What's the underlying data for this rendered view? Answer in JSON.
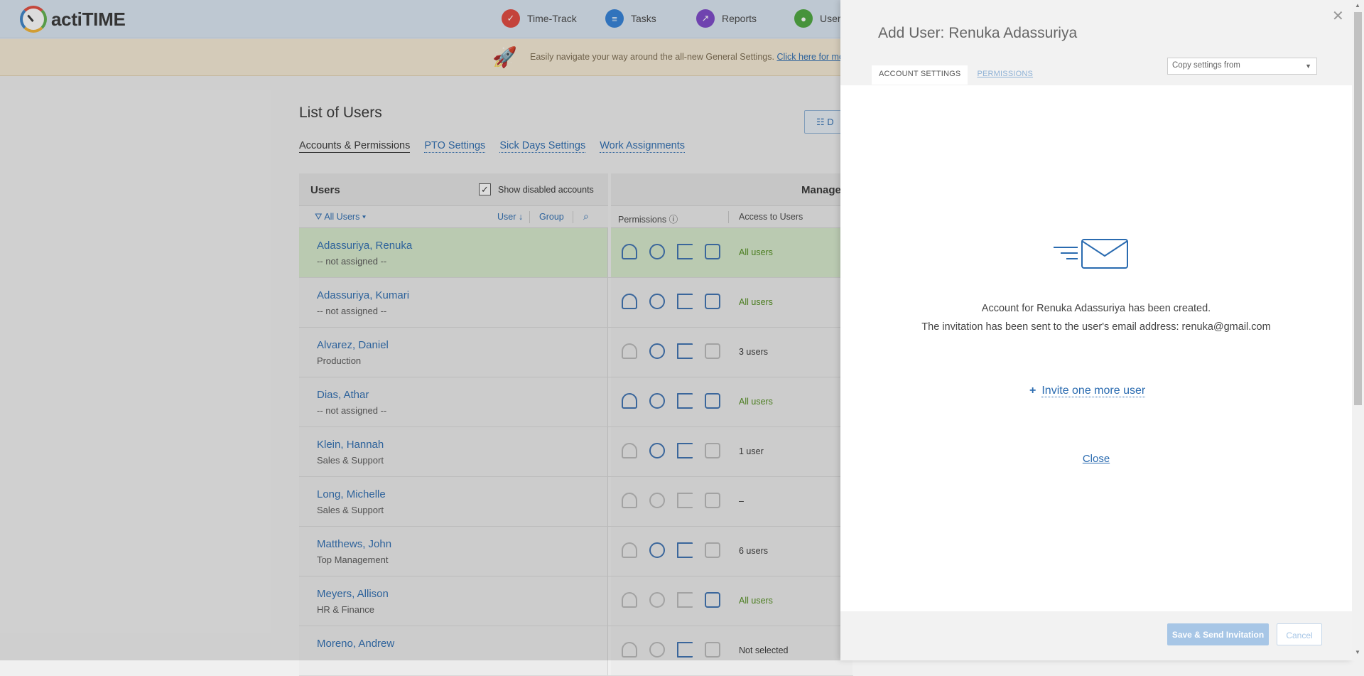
{
  "app": {
    "name": "actiTIME"
  },
  "nav": [
    {
      "label": "Time-Track",
      "icon": "time-track-icon",
      "color": "#e2453b"
    },
    {
      "label": "Tasks",
      "icon": "tasks-icon",
      "color": "#2f7fd8"
    },
    {
      "label": "Reports",
      "icon": "reports-icon",
      "color": "#7b45c9"
    },
    {
      "label": "Users",
      "icon": "users-icon",
      "color": "#4aa63b"
    }
  ],
  "banner": {
    "text": "Easily navigate your way around the all-new General Settings.",
    "link": "Click here for more"
  },
  "page": {
    "title": "List of Users",
    "view_button": "D"
  },
  "subtabs": [
    "Accounts & Permissions",
    "PTO Settings",
    "Sick Days Settings",
    "Work Assignments"
  ],
  "users_header": {
    "title": "Users",
    "show_disabled_label": "Show disabled accounts",
    "show_disabled_checked": true,
    "check_mark": "✓"
  },
  "management_header": {
    "title": "Managem"
  },
  "filters": {
    "all_users": "All Users",
    "user_col": "User",
    "group_col": "Group"
  },
  "perm_columns": {
    "permissions": "Permissions",
    "access": "Access to Users"
  },
  "users": [
    {
      "name": "Adassuriya, Renuka",
      "group": "-- not assigned --",
      "access": "All users",
      "selected": true,
      "perms": [
        true,
        true,
        true,
        true
      ]
    },
    {
      "name": "Adassuriya, Kumari",
      "group": "-- not assigned --",
      "access": "All users",
      "selected": false,
      "perms": [
        true,
        true,
        true,
        true
      ]
    },
    {
      "name": "Alvarez, Daniel",
      "group": "Production",
      "access": "3 users",
      "selected": false,
      "perms": [
        false,
        true,
        true,
        false
      ]
    },
    {
      "name": "Dias, Athar",
      "group": "-- not assigned --",
      "access": "All users",
      "selected": false,
      "perms": [
        true,
        true,
        true,
        true
      ]
    },
    {
      "name": "Klein, Hannah",
      "group": "Sales & Support",
      "access": "1 user",
      "selected": false,
      "perms": [
        false,
        true,
        true,
        false
      ]
    },
    {
      "name": "Long, Michelle",
      "group": "Sales & Support",
      "access": "–",
      "selected": false,
      "perms": [
        false,
        false,
        false,
        false
      ]
    },
    {
      "name": "Matthews, John",
      "group": "Top Management",
      "access": "6 users",
      "selected": false,
      "perms": [
        false,
        true,
        true,
        false
      ]
    },
    {
      "name": "Meyers, Allison",
      "group": "HR & Finance",
      "access": "All users",
      "selected": false,
      "perms": [
        false,
        false,
        false,
        true
      ]
    },
    {
      "name": "Moreno, Andrew",
      "group": "",
      "access": "Not selected",
      "selected": false,
      "perms": [
        false,
        false,
        true,
        false
      ]
    }
  ],
  "panel": {
    "title": "Add User: Renuka Adassuriya",
    "tab_account": "ACCOUNT SETTINGS",
    "tab_permissions": "PERMISSIONS",
    "copy_settings": "Copy settings from",
    "created_msg": "Account for Renuka Adassuriya has been created.",
    "invited_msg": "The invitation has been sent to the user's email address: renuka@gmail.com",
    "invite_more": "Invite one more user",
    "close_link": "Close",
    "save_button": "Save & Send Invitation",
    "cancel_button": "Cancel"
  },
  "colors": {
    "link": "#2a6bb0",
    "selected_row": "#d6e9cb",
    "access_all": "#4f8c1a"
  }
}
